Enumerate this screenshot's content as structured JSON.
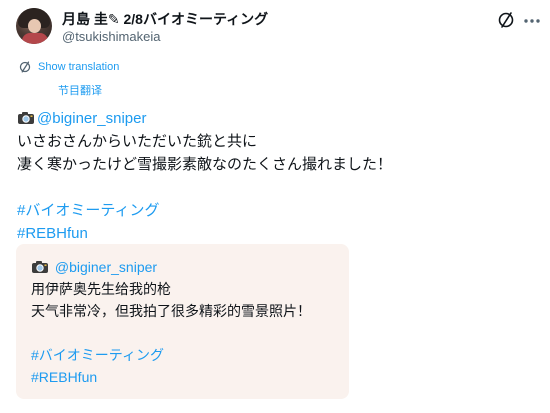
{
  "author": {
    "display_name": "月島 圭✎ 2/8バイオミーティング",
    "handle": "@tsukishimakeia"
  },
  "icons": {
    "avatar": "profile-photo",
    "translate": "translate-icon",
    "more": "more-icon",
    "camera": "camera-emoji"
  },
  "translation": {
    "show_label": "Show translation",
    "sub_label": "节目翻译"
  },
  "tweet": {
    "mention": "@biginer_sniper",
    "line1": "いさおさんからいただいた銃と共に",
    "line2": "凄く寒かったけど雪撮影素敵なのたくさん撮れました！",
    "hashtag1": "#バイオミーティング",
    "hashtag2": "#REBHfun"
  },
  "translated": {
    "mention": "@biginer_sniper",
    "line1": "用伊萨奥先生给我的枪",
    "line2": "天气非常冷，但我拍了很多精彩的雪景照片！",
    "hashtag1": "#バイオミーティング",
    "hashtag2": "#REBHfun"
  },
  "colors": {
    "link": "#1d9bf0",
    "text": "#0f1419",
    "muted": "#536471",
    "translated_bg": "#faf2ee"
  }
}
